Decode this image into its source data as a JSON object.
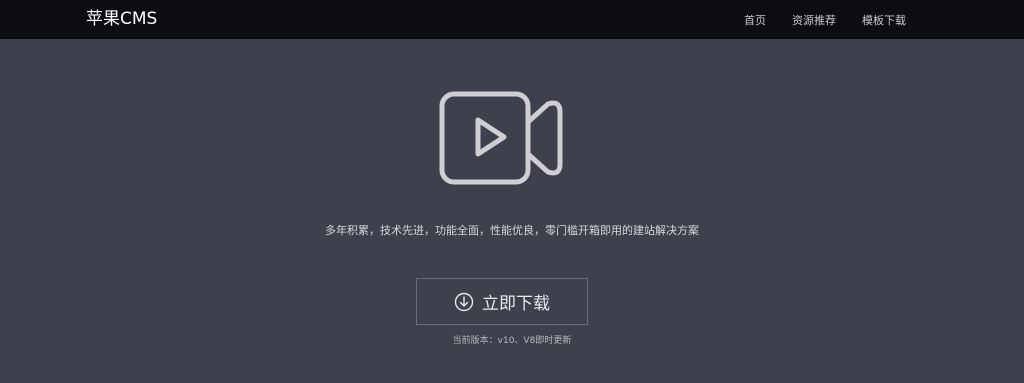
{
  "header": {
    "brand": "苹果CMS",
    "nav": [
      {
        "label": "首页"
      },
      {
        "label": "资源推荐"
      },
      {
        "label": "模板下载"
      }
    ]
  },
  "hero": {
    "icon": "video-camera-play-icon",
    "tagline": "多年积累，技术先进，功能全面，性能优良，零门槛开箱即用的建站解决方案",
    "download_label": "立即下载",
    "download_icon": "download-arrow-icon",
    "version_text": "当前版本：v10、V8即时更新"
  },
  "colors": {
    "navbar_bg": "#0c0d10",
    "page_bg": "#3e404b",
    "icon_stroke": "#cfcfd3",
    "button_border": "#686a74"
  }
}
